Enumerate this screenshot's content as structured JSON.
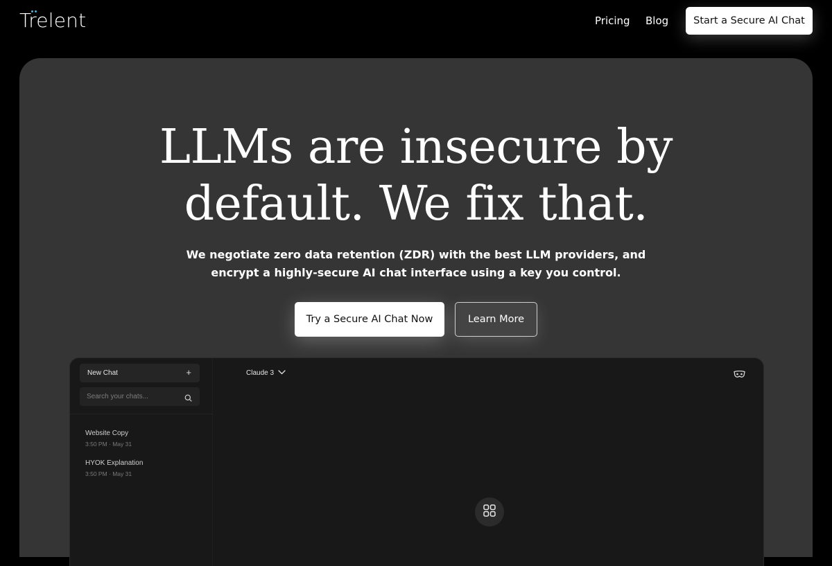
{
  "nav": {
    "logo": "Trelent",
    "links": [
      {
        "label": "Pricing"
      },
      {
        "label": "Blog"
      }
    ],
    "cta_label": "Start a Secure AI Chat"
  },
  "hero": {
    "title_line1": "LLMs are insecure by",
    "title_line2": "default. We fix that.",
    "subtitle_line1": "We negotiate zero data retention (ZDR) with the best LLM providers, and",
    "subtitle_line2": "encrypt a highly-secure AI chat interface using a key you control.",
    "primary_button": "Try a Secure AI Chat Now",
    "secondary_button": "Learn More"
  },
  "mockup": {
    "new_chat_label": "New Chat",
    "search_placeholder": "Search your chats...",
    "chats": [
      {
        "title": "Website Copy",
        "meta": "3:50 PM · May 31"
      },
      {
        "title": "HYOK Explanation",
        "meta": "3:50 PM · May 31"
      }
    ],
    "model_selector": "Claude 3",
    "icons": {
      "new_chat": "plus-icon",
      "search": "search-icon",
      "model": "chevron-down-icon",
      "incognito": "incognito-mask-icon",
      "apps": "grid-icon"
    }
  },
  "colors": {
    "page_bg": "#000000",
    "hero_bg": "#353535",
    "mock_bg": "#181818",
    "logo_accent": "#4fb3d9",
    "button_bg": "#ffffff"
  }
}
